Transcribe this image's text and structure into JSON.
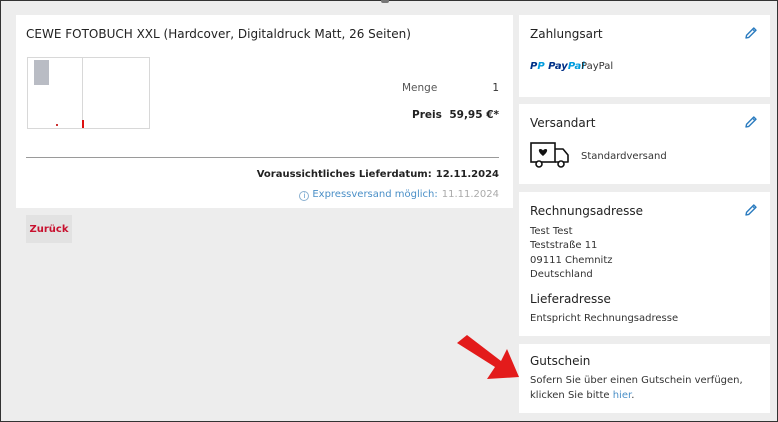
{
  "product": {
    "title": "CEWE FOTOBUCH XXL (Hardcover, Digitaldruck Matt, 26 Seiten)",
    "quantity_label": "Menge",
    "quantity_value": "1",
    "price_label": "Preis",
    "price_value": "59,95 €*",
    "delivery_label": "Voraussichtliches Lieferdatum:",
    "delivery_date": "12.11.2024",
    "express_info_icon": "info-icon",
    "express_label": "Expressversand möglich:",
    "express_date": "11.11.2024"
  },
  "back_button_label": "Zurück",
  "payment": {
    "title": "Zahlungsart",
    "logo_pay": "PayPal",
    "logo_text": "PayPal",
    "method": "PayPal"
  },
  "shipping": {
    "title": "Versandart",
    "method": "Standardversand"
  },
  "billing": {
    "title": "Rechnungsadresse",
    "name": "Test Test",
    "street": "Teststraße 11",
    "city": "09111 Chemnitz",
    "country": "Deutschland"
  },
  "delivery_address": {
    "title": "Lieferadresse",
    "text": "Entspricht Rechnungsadresse"
  },
  "voucher": {
    "title": "Gutschein",
    "text": "Sofern Sie über einen Gutschein verfügen, klicken Sie bitte",
    "link": "hier",
    "suffix": "."
  },
  "colors": {
    "accent_red": "#c8102e",
    "link_blue": "#4a8fc7",
    "edit_blue": "#2a7bbf",
    "background": "#ededed",
    "arrow_red": "#e31b1b"
  }
}
